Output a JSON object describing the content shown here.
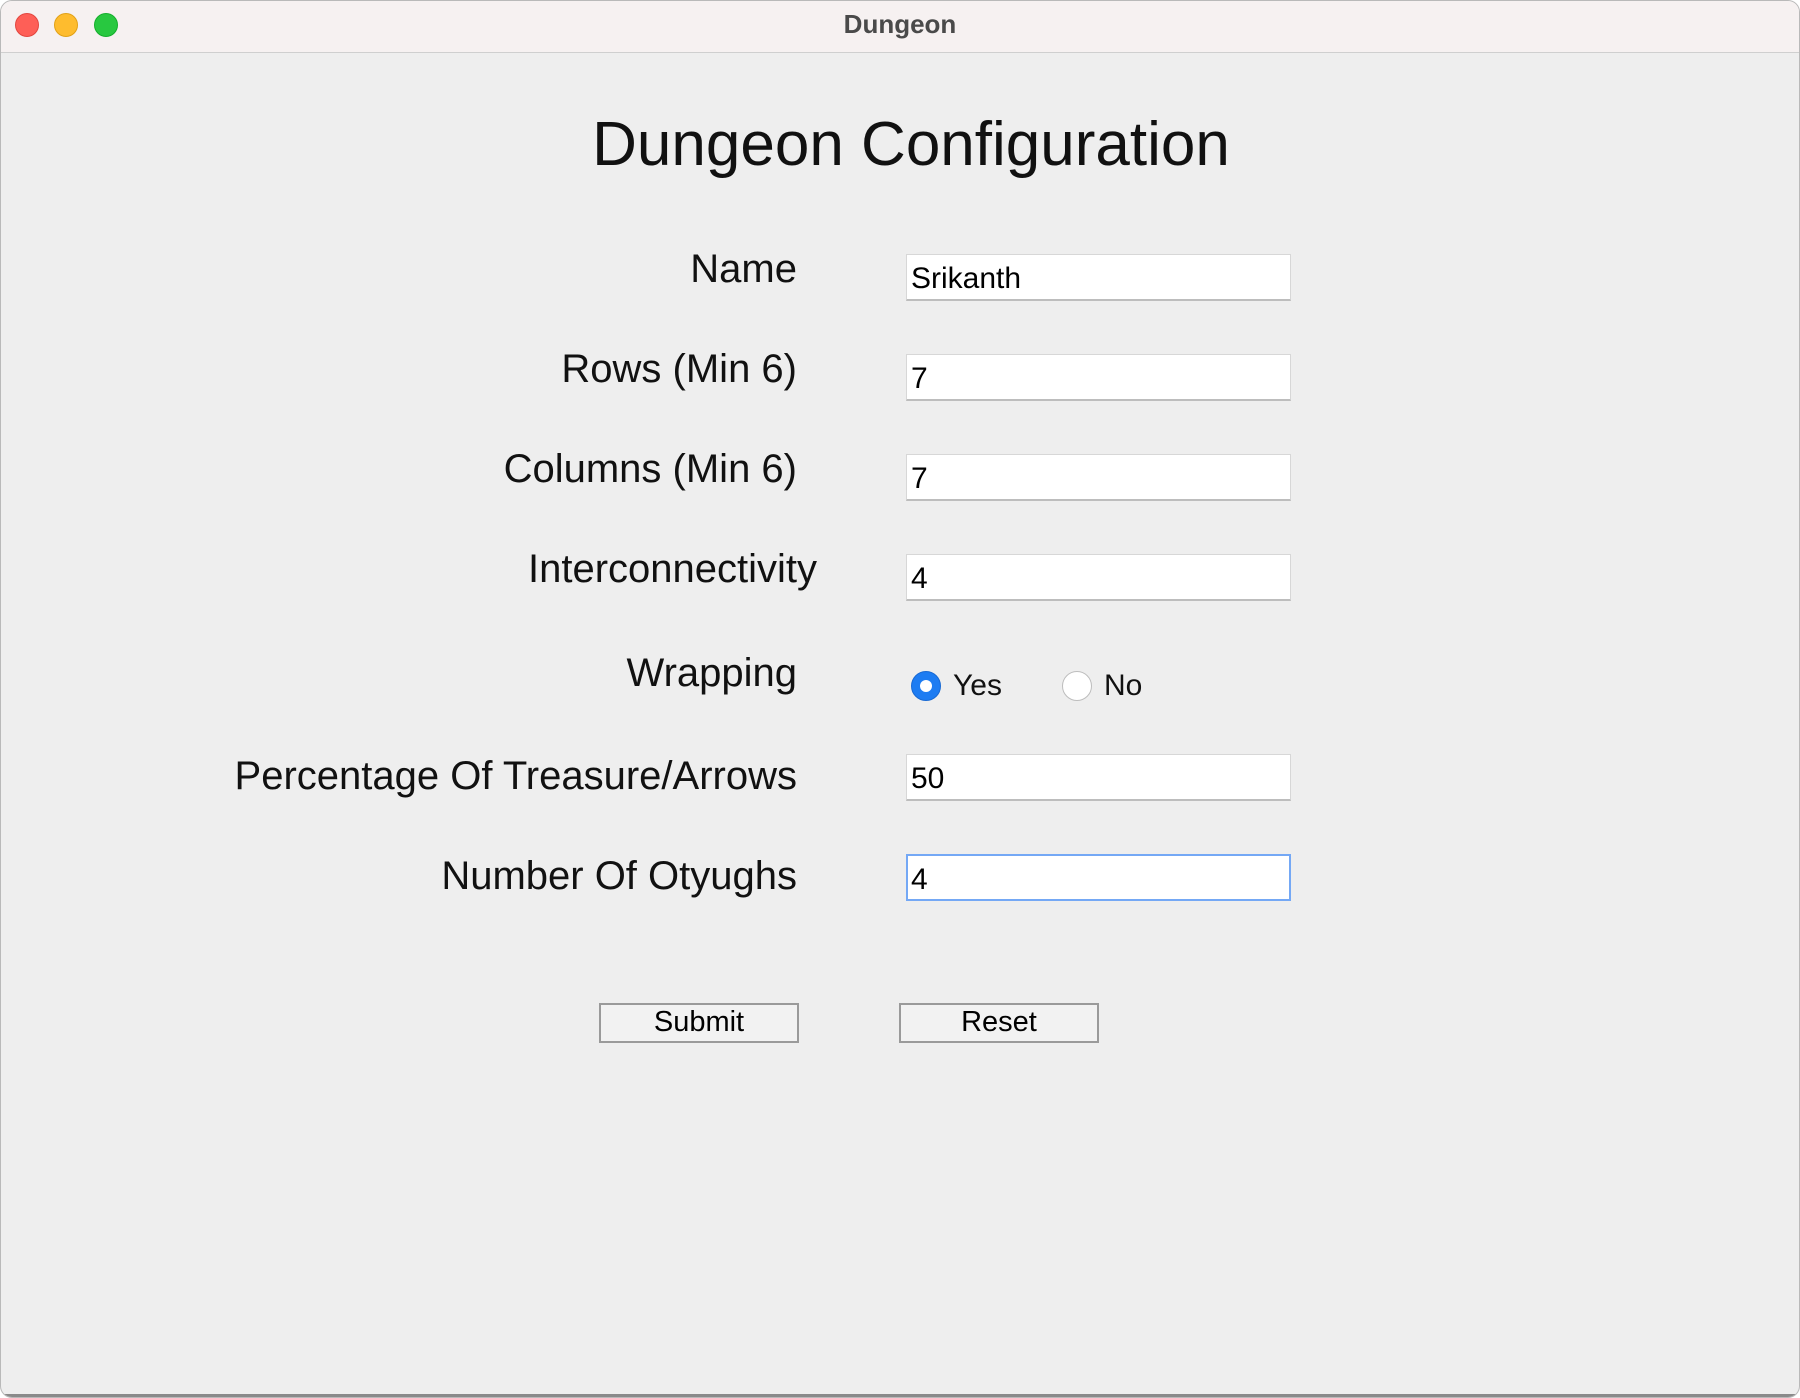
{
  "window": {
    "title": "Dungeon"
  },
  "form": {
    "heading": "Dungeon Configuration",
    "name": {
      "label": "Name",
      "value": "Srikanth"
    },
    "rows": {
      "label": "Rows (Min 6)",
      "value": "7"
    },
    "columns": {
      "label": "Columns (Min 6)",
      "value": "7"
    },
    "interconnectivity": {
      "label": "Interconnectivity",
      "value": "4"
    },
    "wrapping": {
      "label": "Wrapping",
      "yes_label": "Yes",
      "no_label": "No",
      "selected": "Yes"
    },
    "percentage": {
      "label": "Percentage Of Treasure/Arrows",
      "value": "50"
    },
    "otyughs": {
      "label": "Number Of Otyughs",
      "value": "4"
    }
  },
  "buttons": {
    "submit_label": "Submit",
    "reset_label": "Reset"
  },
  "colors": {
    "accent": "#1d7cf2",
    "focus_ring": "#74a8f5",
    "window_bg": "#eeeeee"
  }
}
